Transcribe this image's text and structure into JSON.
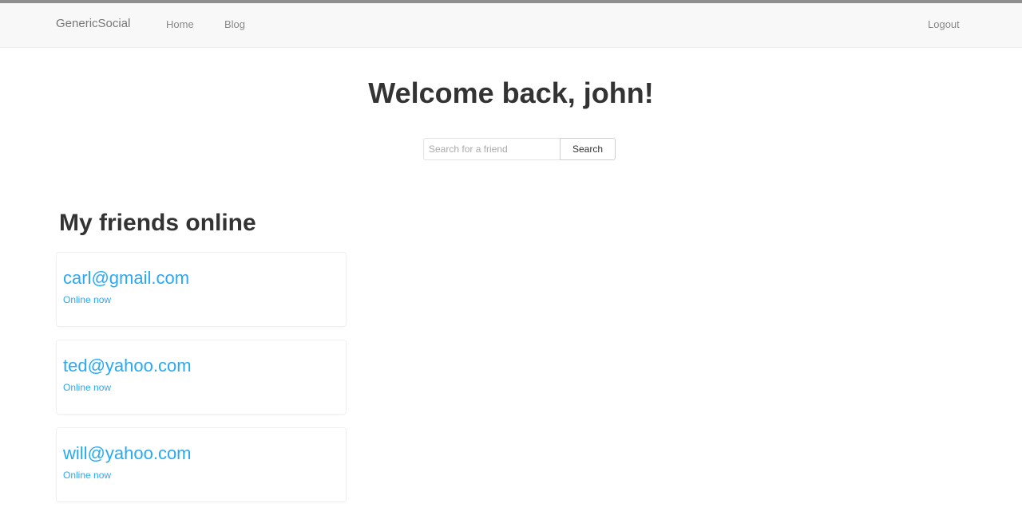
{
  "navbar": {
    "brand": "GenericSocial",
    "links": [
      "Home",
      "Blog"
    ],
    "logout": "Logout"
  },
  "header": {
    "welcome": "Welcome back, john!"
  },
  "search": {
    "placeholder": "Search for a friend",
    "button_label": "Search"
  },
  "friends_section": {
    "title": "My friends online",
    "friends": [
      {
        "email": "carl@gmail.com",
        "status": "Online now"
      },
      {
        "email": "ted@yahoo.com",
        "status": "Online now"
      },
      {
        "email": "will@yahoo.com",
        "status": "Online now"
      }
    ]
  },
  "colors": {
    "link": "#27a9f5",
    "navbar_bg": "#f8f8f8",
    "heading": "#333333"
  }
}
